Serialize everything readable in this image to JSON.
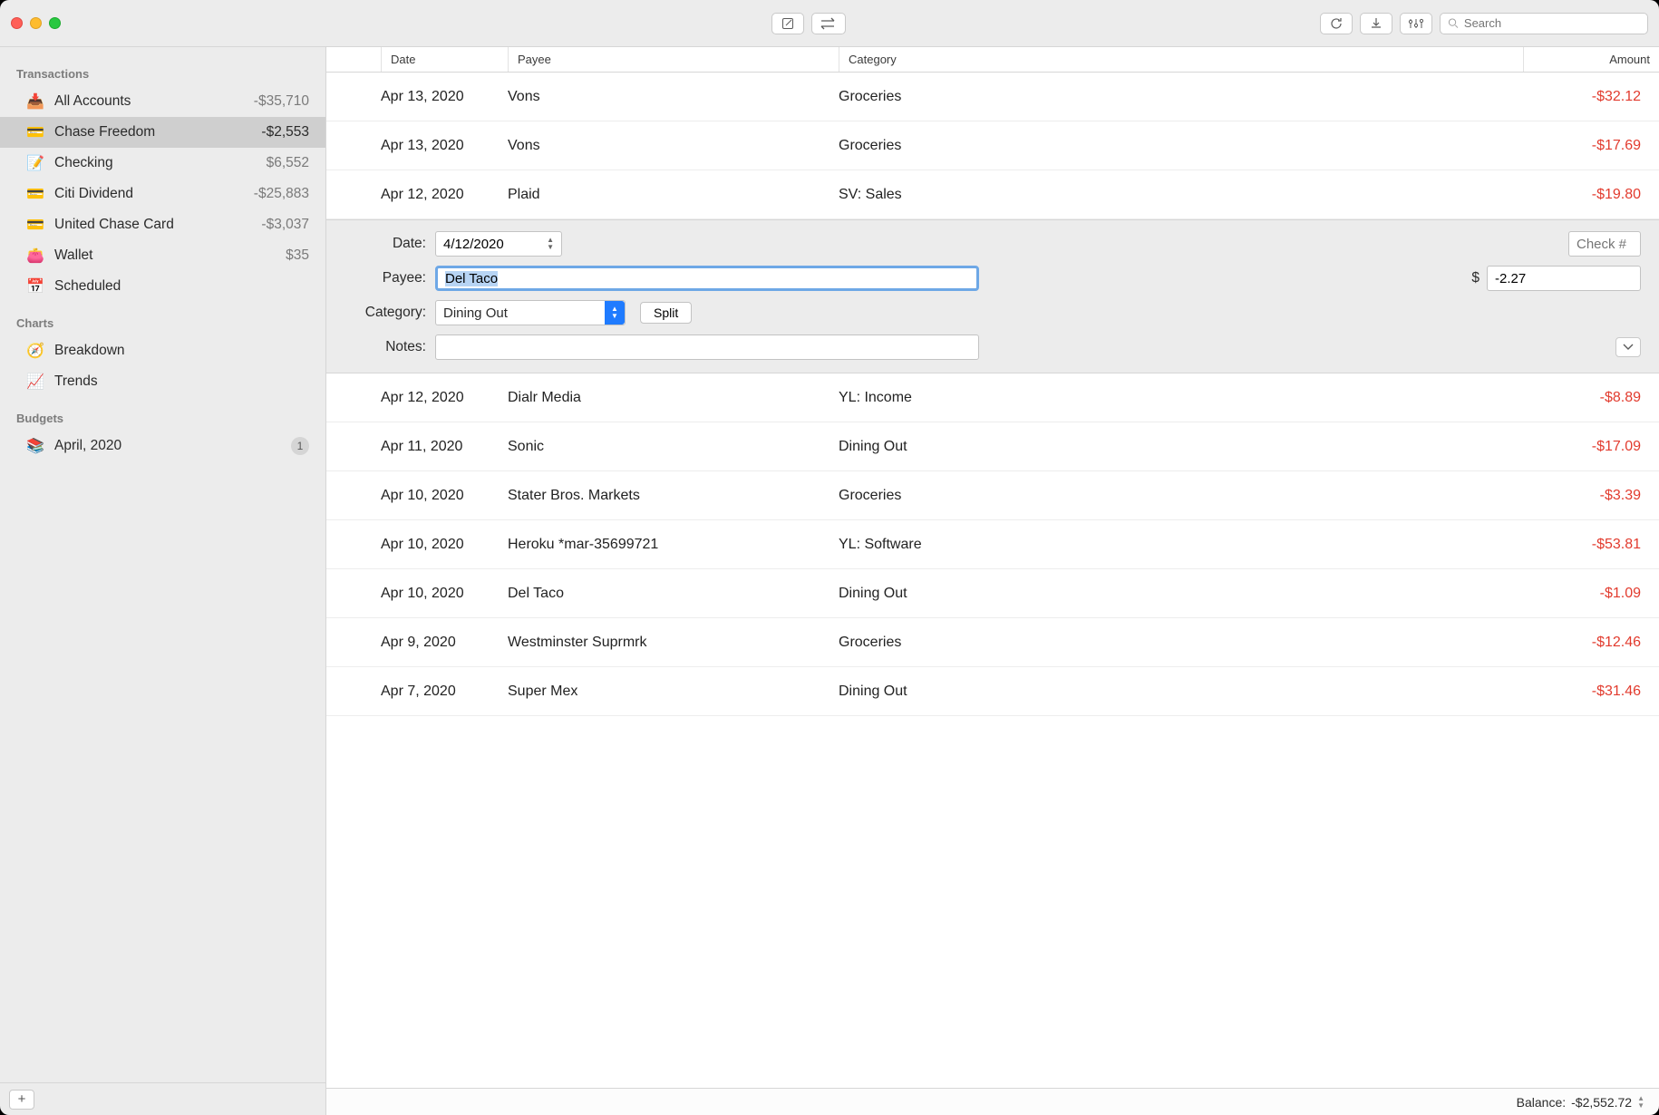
{
  "search": {
    "placeholder": "Search"
  },
  "sidebar": {
    "sections": [
      {
        "title": "Transactions",
        "items": [
          {
            "icon": "📥",
            "label": "All Accounts",
            "amount": "-$35,710",
            "selected": false
          },
          {
            "icon": "💳",
            "label": "Chase Freedom",
            "amount": "-$2,553",
            "selected": true
          },
          {
            "icon": "📝",
            "label": "Checking",
            "amount": "$6,552",
            "selected": false
          },
          {
            "icon": "💳",
            "label": "Citi Dividend",
            "amount": "-$25,883",
            "selected": false
          },
          {
            "icon": "💳",
            "label": "United Chase Card",
            "amount": "-$3,037",
            "selected": false
          },
          {
            "icon": "👛",
            "label": "Wallet",
            "amount": "$35",
            "selected": false
          },
          {
            "icon": "📅",
            "label": "Scheduled",
            "amount": "",
            "selected": false
          }
        ]
      },
      {
        "title": "Charts",
        "items": [
          {
            "icon": "🧭",
            "label": "Breakdown",
            "amount": "",
            "selected": false
          },
          {
            "icon": "📈",
            "label": "Trends",
            "amount": "",
            "selected": false
          }
        ]
      },
      {
        "title": "Budgets",
        "items": [
          {
            "icon": "📚",
            "label": "April, 2020",
            "badge": "1",
            "selected": false
          }
        ]
      }
    ]
  },
  "columns": {
    "date": "Date",
    "payee": "Payee",
    "category": "Category",
    "amount": "Amount"
  },
  "transactions_top": [
    {
      "date": "Apr 13, 2020",
      "payee": "Vons",
      "category": "Groceries",
      "amount": "-$32.12"
    },
    {
      "date": "Apr 13, 2020",
      "payee": "Vons",
      "category": "Groceries",
      "amount": "-$17.69"
    },
    {
      "date": "Apr 12, 2020",
      "payee": "Plaid",
      "category": "SV: Sales",
      "amount": "-$19.80"
    }
  ],
  "editor": {
    "labels": {
      "date": "Date:",
      "payee": "Payee:",
      "category": "Category:",
      "notes": "Notes:"
    },
    "date": "4/12/2020",
    "check_placeholder": "Check #",
    "payee": "Del Taco",
    "currency": "$",
    "amount": "-2.27",
    "category": "Dining Out",
    "split_label": "Split",
    "notes": ""
  },
  "transactions_bottom": [
    {
      "date": "Apr 12, 2020",
      "payee": "Dialr Media",
      "category": "YL: Income",
      "amount": "-$8.89"
    },
    {
      "date": "Apr 11, 2020",
      "payee": "Sonic",
      "category": "Dining Out",
      "amount": "-$17.09"
    },
    {
      "date": "Apr 10, 2020",
      "payee": "Stater Bros. Markets",
      "category": "Groceries",
      "amount": "-$3.39"
    },
    {
      "date": "Apr 10, 2020",
      "payee": "Heroku *mar-35699721",
      "category": "YL: Software",
      "amount": "-$53.81"
    },
    {
      "date": "Apr 10, 2020",
      "payee": "Del Taco",
      "category": "Dining Out",
      "amount": "-$1.09"
    },
    {
      "date": "Apr 9, 2020",
      "payee": "Westminster Suprmrk",
      "category": "Groceries",
      "amount": "-$12.46"
    },
    {
      "date": "Apr 7, 2020",
      "payee": "Super Mex",
      "category": "Dining Out",
      "amount": "-$31.46"
    }
  ],
  "status": {
    "balance_label": "Balance:",
    "balance_value": "-$2,552.72"
  }
}
